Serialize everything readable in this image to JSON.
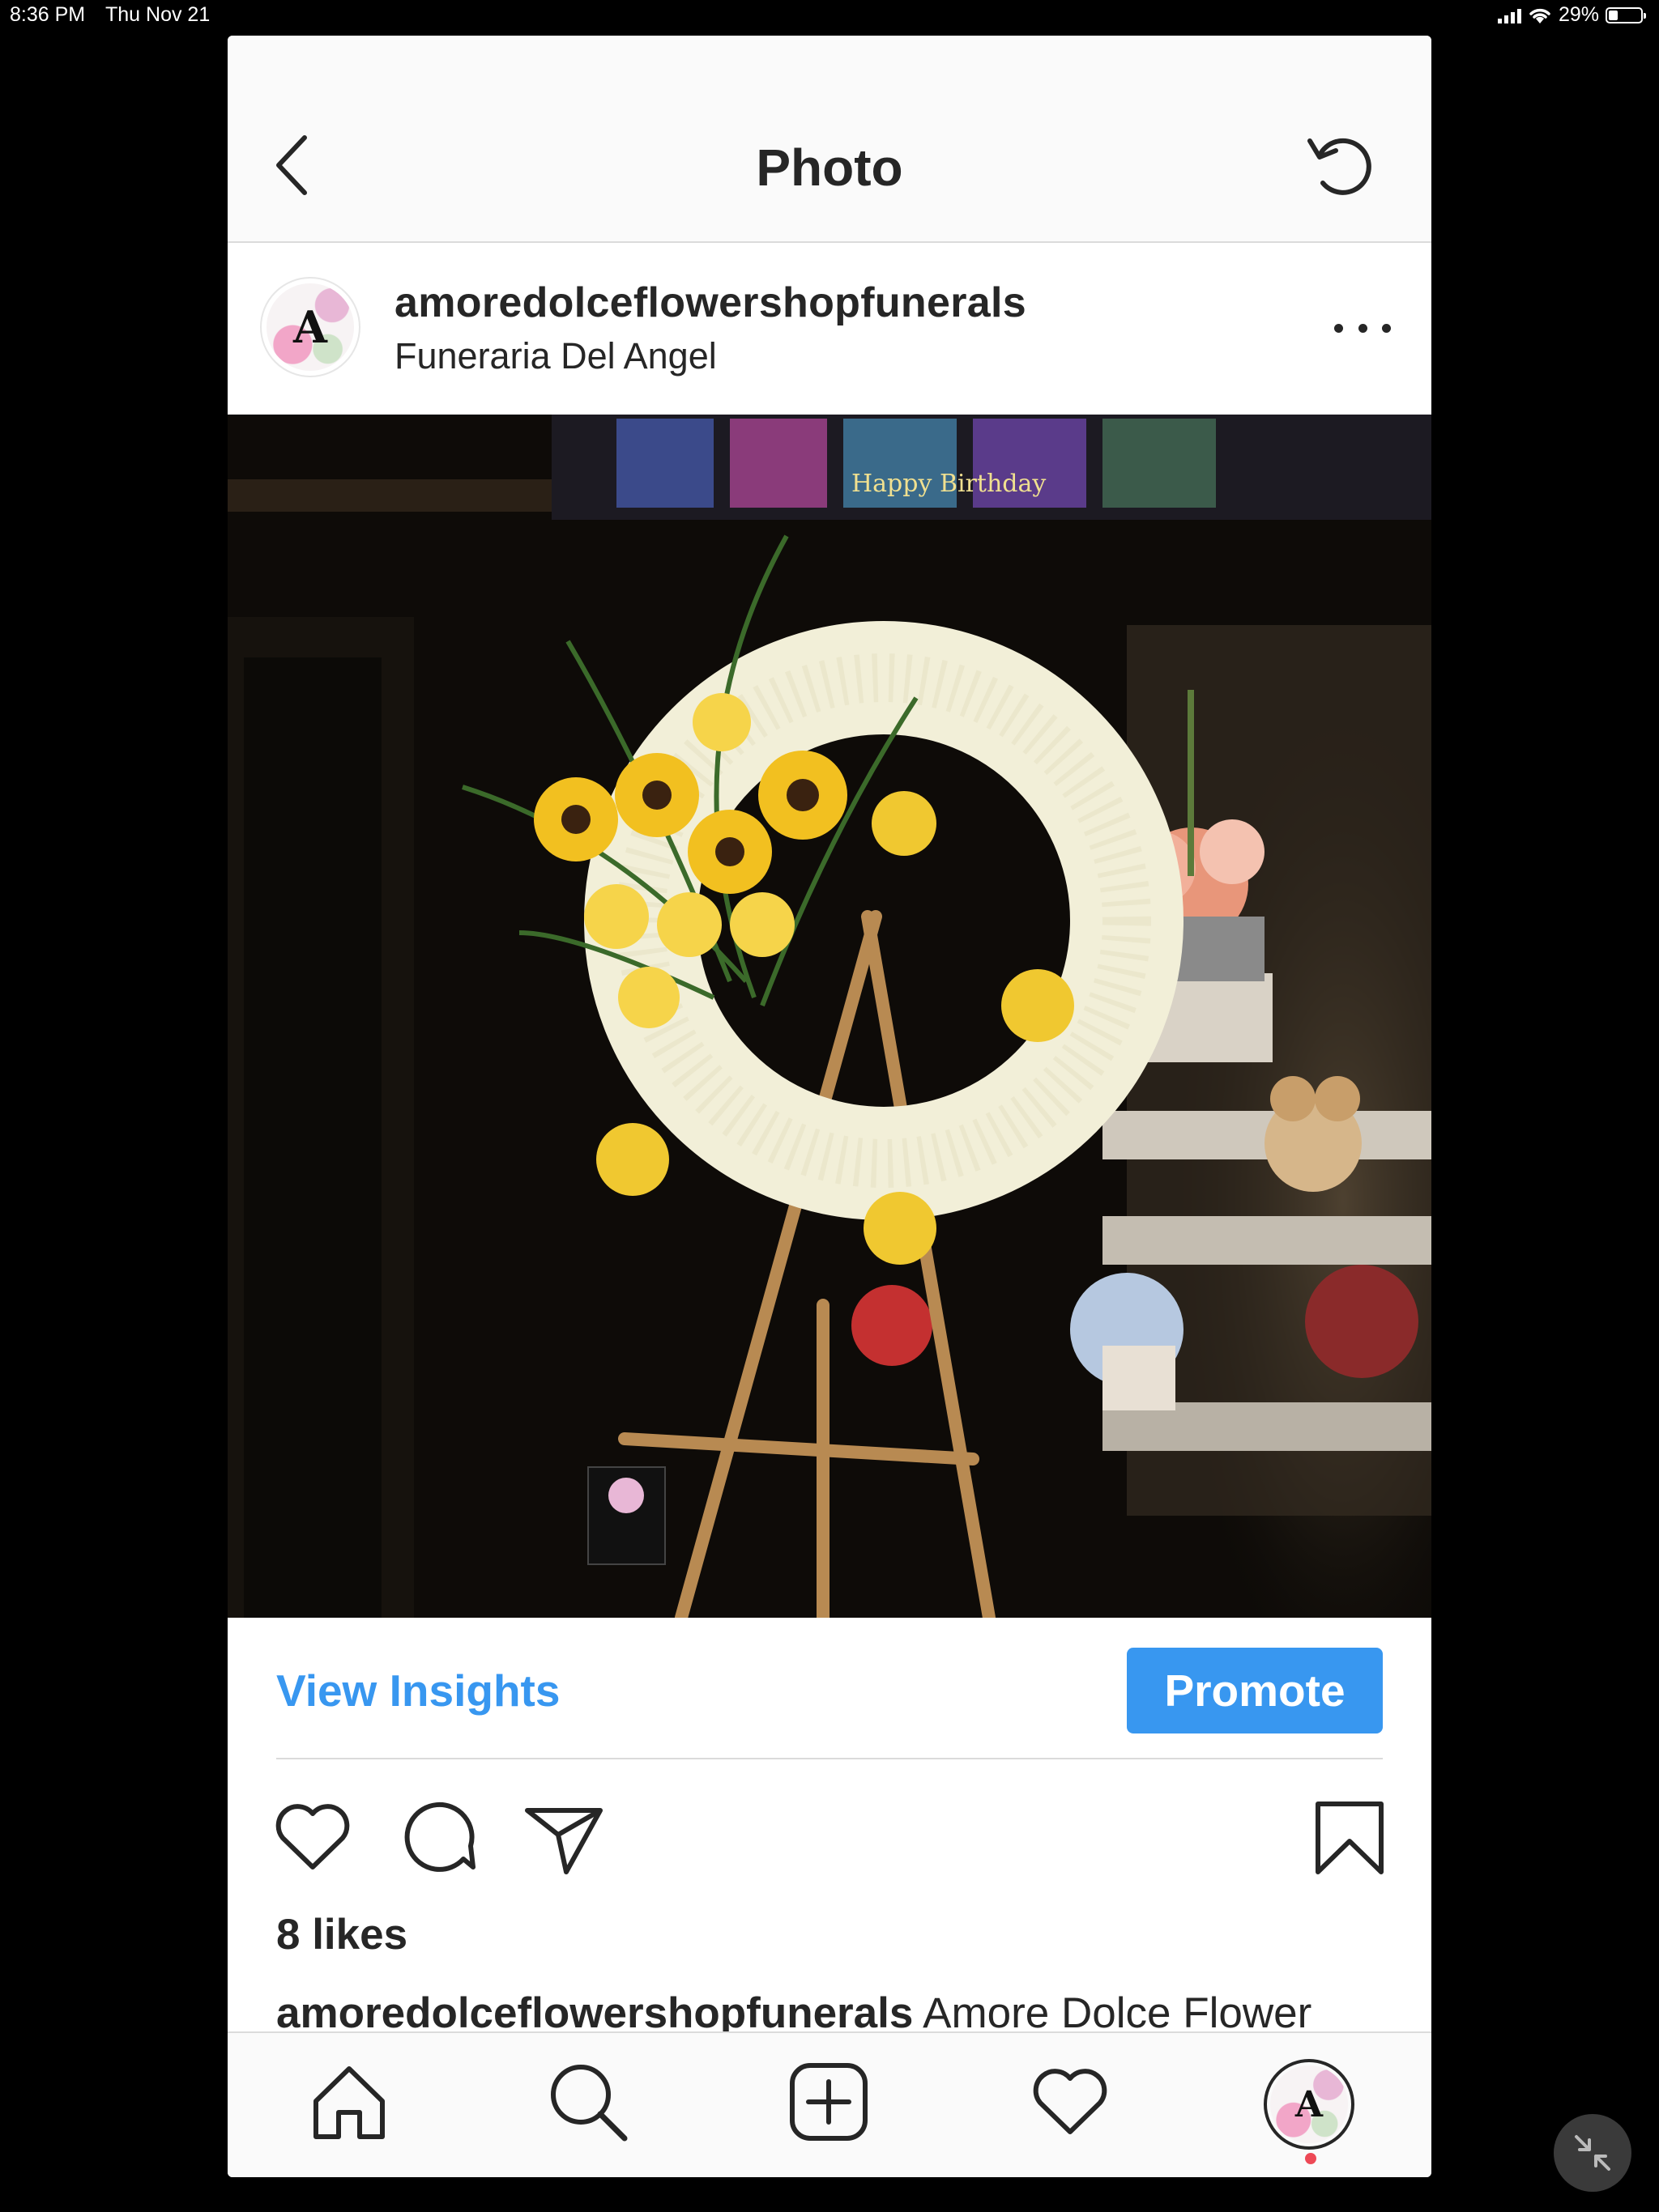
{
  "status_bar": {
    "time": "8:36 PM",
    "date": "Thu Nov 21",
    "battery": "29%",
    "battery_level": 0.29
  },
  "nav": {
    "title": "Photo"
  },
  "post": {
    "avatar_letter": "A",
    "username": "amoredolceflowershopfunerals",
    "location": "Funeraria Del Angel",
    "photo_sign_text": "Happy Birthday"
  },
  "insights": {
    "view_label": "View Insights",
    "promote_label": "Promote"
  },
  "likes": "8 likes",
  "caption": {
    "username": "amoredolceflowershopfunerals",
    "text": "Amore Dolce Flower"
  },
  "tab_icons": [
    "home-icon",
    "search-icon",
    "add-post-icon",
    "activity-heart-icon",
    "profile-avatar"
  ],
  "colors": {
    "accent": "#3897f0",
    "text": "#262626",
    "notification": "#ed4956"
  }
}
